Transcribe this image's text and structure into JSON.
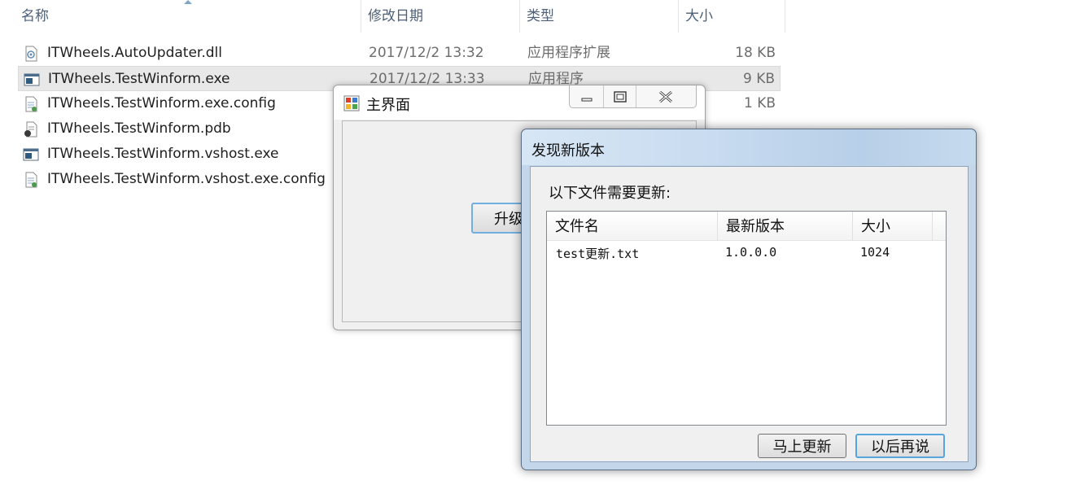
{
  "explorer": {
    "columns": {
      "name": "名称",
      "date": "修改日期",
      "type": "类型",
      "size": "大小"
    },
    "files": [
      {
        "name": "ITWheels.AutoUpdater.dll",
        "date": "2017/12/2 13:32",
        "type": "应用程序扩展",
        "size": "18 KB",
        "icon": "dll-file-icon"
      },
      {
        "name": "ITWheels.TestWinform.exe",
        "date": "2017/12/2 13:33",
        "type": "应用程序",
        "size": "9 KB",
        "icon": "exe-file-icon"
      },
      {
        "name": "ITWheels.TestWinform.exe.config",
        "date": "",
        "type": "",
        "size": "1 KB",
        "icon": "config-file-icon"
      },
      {
        "name": "ITWheels.TestWinform.pdb",
        "date": "",
        "type": "",
        "size": "",
        "icon": "pdb-file-icon"
      },
      {
        "name": "ITWheels.TestWinform.vshost.exe",
        "date": "",
        "type": "",
        "size": "",
        "icon": "exe-file-icon"
      },
      {
        "name": "ITWheels.TestWinform.vshost.exe.config",
        "date": "",
        "type": "",
        "size": "",
        "icon": "config-file-icon"
      }
    ]
  },
  "main_window": {
    "title": "主界面",
    "upgrade_button": "升级"
  },
  "update_dialog": {
    "title": "发现新版本",
    "prompt": "以下文件需要更新:",
    "columns": [
      "文件名",
      "最新版本",
      "大小"
    ],
    "rows": [
      {
        "file": "test更新.txt",
        "version": "1.0.0.0",
        "size": "1024"
      }
    ],
    "update_now_button": "马上更新",
    "later_button": "以后再说"
  },
  "colors": {
    "dialog_frame": "#c3d6ea",
    "button_focus": "#57a5dd",
    "header_text": "#4c607a"
  }
}
